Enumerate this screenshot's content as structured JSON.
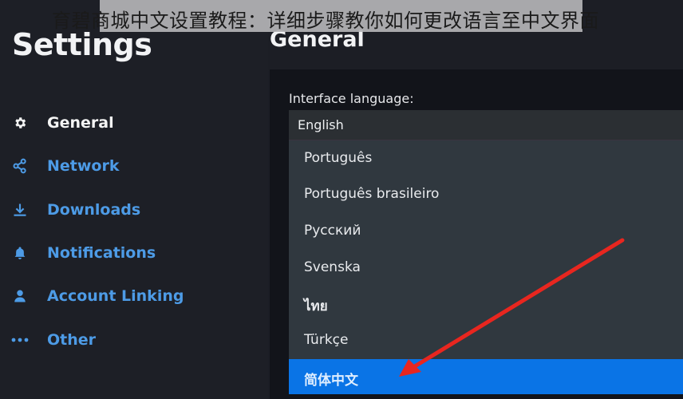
{
  "watermark": "育碧商城中文设置教程：详细步骤教你如何更改语言至中文界面",
  "sidebar": {
    "title": "Settings",
    "items": [
      {
        "label": "General",
        "icon": "gear-icon",
        "active": true
      },
      {
        "label": "Network",
        "icon": "network-icon",
        "active": false
      },
      {
        "label": "Downloads",
        "icon": "download-icon",
        "active": false
      },
      {
        "label": "Notifications",
        "icon": "bell-icon",
        "active": false
      },
      {
        "label": "Account Linking",
        "icon": "user-icon",
        "active": false
      },
      {
        "label": "Other",
        "icon": "ellipsis-icon",
        "active": false
      }
    ]
  },
  "main": {
    "title": "General",
    "language": {
      "label": "Interface language:",
      "value": "English",
      "options": [
        {
          "label": "Português"
        },
        {
          "label": "Português brasileiro"
        },
        {
          "label": "Русский"
        },
        {
          "label": "Svenska"
        },
        {
          "label": "ไทย"
        },
        {
          "label": "Türkçe"
        },
        {
          "label": "简体中文",
          "highlighted": true
        }
      ]
    }
  },
  "annotation": {
    "type": "red-arrow",
    "color": "#e8261f",
    "points_to": "简体中文"
  },
  "colors": {
    "accent": "#4d9be6",
    "highlight": "#0a74e6"
  }
}
